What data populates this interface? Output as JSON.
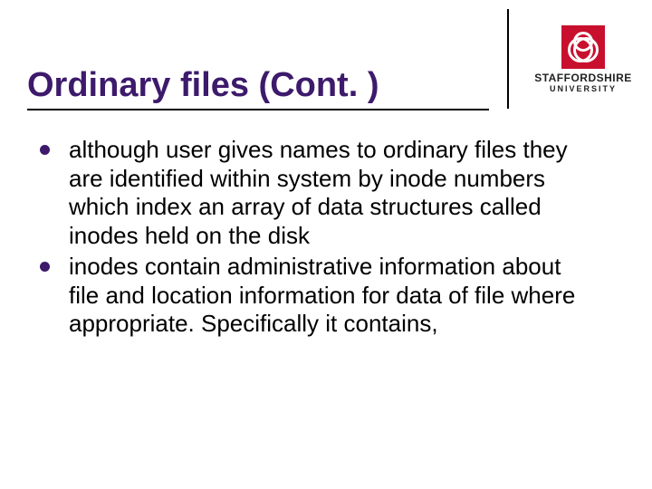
{
  "title": "Ordinary files (Cont. )",
  "logo": {
    "line1": "STAFFORDSHIRE",
    "line2": "UNIVERSITY"
  },
  "bullets": [
    "although user gives names to ordinary files they are identified within system by inode numbers which index an array of data structures called inodes held on the disk",
    "inodes contain administrative information about file and location information for data of file where appropriate. Specifically it contains,"
  ]
}
